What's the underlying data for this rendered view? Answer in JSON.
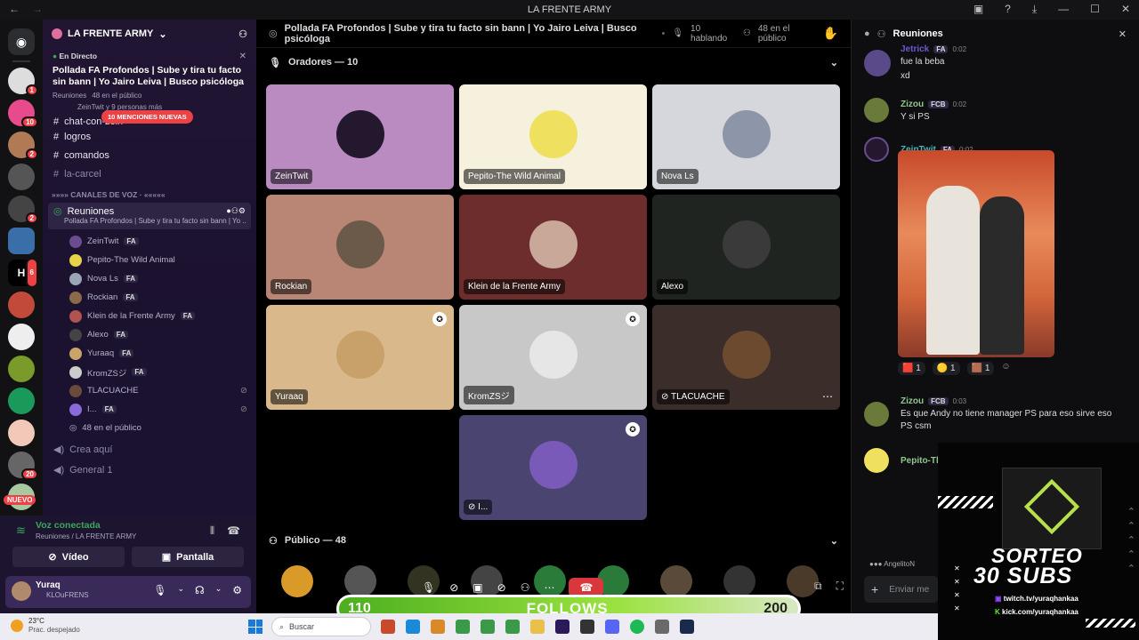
{
  "window": {
    "title": "LA FRENTE ARMY"
  },
  "server": {
    "name": "LA FRENTE ARMY"
  },
  "live": {
    "badge": "En Directo",
    "title": "Pollada FA Profondos | Sube y tira tu facto sin bann | Yo Jairo Leiva | Busco psicóloga",
    "channel": "Reuniones",
    "audience": "48 en el público",
    "viewers": "ZeinTwit y 9 personas más"
  },
  "channels": [
    {
      "name": "chat-con-zein"
    },
    {
      "name": "logros",
      "badge": "10 MENCIONES NUEVAS"
    },
    {
      "name": "comandos"
    },
    {
      "name": "la-carcel"
    }
  ],
  "voice_category": "»»»» CANALES DE VOZ · «««««",
  "stage_channel": {
    "name": "Reuniones",
    "topic": "Pollada FA Profondos | Sube y tira tu facto sin bann | Yo ..."
  },
  "members": [
    {
      "name": "ZeinTwit",
      "tag": "FA",
      "color": "#6a4c8f"
    },
    {
      "name": "Pepito-The Wild Animal",
      "tag": "",
      "color": "#e6d34a"
    },
    {
      "name": "Nova Ls",
      "tag": "FA",
      "color": "#9aa5b5"
    },
    {
      "name": "Rockian",
      "tag": "FA",
      "color": "#8a6a4a"
    },
    {
      "name": "Klein de la Frente Army",
      "tag": "FA",
      "color": "#b0544f"
    },
    {
      "name": "Alexo",
      "tag": "FA",
      "color": "#444"
    },
    {
      "name": "Yuraaq",
      "tag": "FA",
      "color": "#c9a36a"
    },
    {
      "name": "KromZSジ",
      "tag": "FA",
      "color": "#ccc"
    },
    {
      "name": "TLACUACHE",
      "tag": "",
      "color": "#6a4a3a"
    },
    {
      "name": "I...",
      "tag": "FA",
      "color": "#8a6ad8"
    }
  ],
  "audience_line": "48 en el público",
  "other_channels": [
    {
      "name": "Crea aquí"
    },
    {
      "name": "General 1"
    }
  ],
  "voice_status": {
    "label": "Voz conectada",
    "sub": "Reuniones / LA FRENTE ARMY",
    "video": "Vídeo",
    "screen": "Pantalla"
  },
  "user": {
    "name": "Yuraq",
    "status": "KLOuFRENS"
  },
  "nuevo_badge": "NUEVO",
  "stage_header": {
    "title": "Pollada FA Profondos | Sube y tira tu facto sin bann | Yo Jairo Leiva | Busco psicóloga",
    "speaking": "10 hablando",
    "audience": "48 en el público"
  },
  "speakers_section": "Oradores — 10",
  "audience_section": "Público — 48",
  "tiles": [
    {
      "name": "ZeinTwit",
      "bg": "#b98bc0",
      "pic": "#23182e",
      "mod": false
    },
    {
      "name": "Pepito-The Wild Animal",
      "bg": "#f5f1dc",
      "pic": "#f0e060",
      "mod": false
    },
    {
      "name": "Nova Ls",
      "bg": "#d6d7dc",
      "pic": "#8d96a8",
      "mod": false
    },
    {
      "name": "Rockian",
      "bg": "#b98574",
      "pic": "#6b5a4a",
      "mod": false
    },
    {
      "name": "Klein de la Frente Army",
      "bg": "#6e2d2d",
      "pic": "#c9a89a",
      "mod": false
    },
    {
      "name": "Alexo",
      "bg": "#1f2421",
      "pic": "#3a3a3a",
      "mod": false
    },
    {
      "name": "Yuraaq",
      "bg": "#d9b98c",
      "pic": "#c8a06a",
      "mod": true
    },
    {
      "name": "KromZSジ",
      "bg": "#c8c8c8",
      "pic": "#e6e6e6",
      "mod": true
    },
    {
      "name": "TLACUACHE",
      "bg": "#3b2e2a",
      "pic": "#6b4a30",
      "mod": false
    },
    {
      "name": "I...",
      "bg": "#4a4570",
      "pic": "#7a5ab8",
      "mod": true
    }
  ],
  "chat": {
    "title": "Reuniones",
    "messages": [
      {
        "user": "Jetrick",
        "tag": "FA",
        "time": "0:02",
        "lines": [
          "fue la beba",
          "xd"
        ],
        "color": "#6a5acd"
      },
      {
        "user": "Zizou",
        "tag": "FCB",
        "time": "0:02",
        "lines": [
          "Y si PS"
        ],
        "color": "#8fc88f"
      },
      {
        "user": "ZeinTwit",
        "tag": "FA",
        "time": "0:02",
        "lines": [],
        "color": "#3fb7c7"
      },
      {
        "user": "Zizou",
        "tag": "FCB",
        "time": "0:03",
        "lines": [
          "Es que Andy no tiene manager PS  para eso sirve eso",
          "PS csm"
        ],
        "color": "#8fc88f"
      },
      {
        "user": "Pepito-Th",
        "tag": "",
        "time": "",
        "lines": [],
        "color": "#8fc88f"
      }
    ],
    "reactions": [
      "1",
      "1",
      "1"
    ],
    "typing": "AngelitoN",
    "input_placeholder": "Enviar me"
  },
  "overlay": {
    "title1": "SORTEO",
    "title2": "30 SUBS",
    "link1": "twitch.tv/yuraqhankaa",
    "link2": "kick.com/yuraqhankaa"
  },
  "follows": {
    "current": "110",
    "label": "FOLLOWS",
    "goal": "200"
  },
  "weather": {
    "temp": "23°C",
    "desc": "Prac. despejado"
  },
  "taskbar": {
    "search": "Buscar"
  }
}
